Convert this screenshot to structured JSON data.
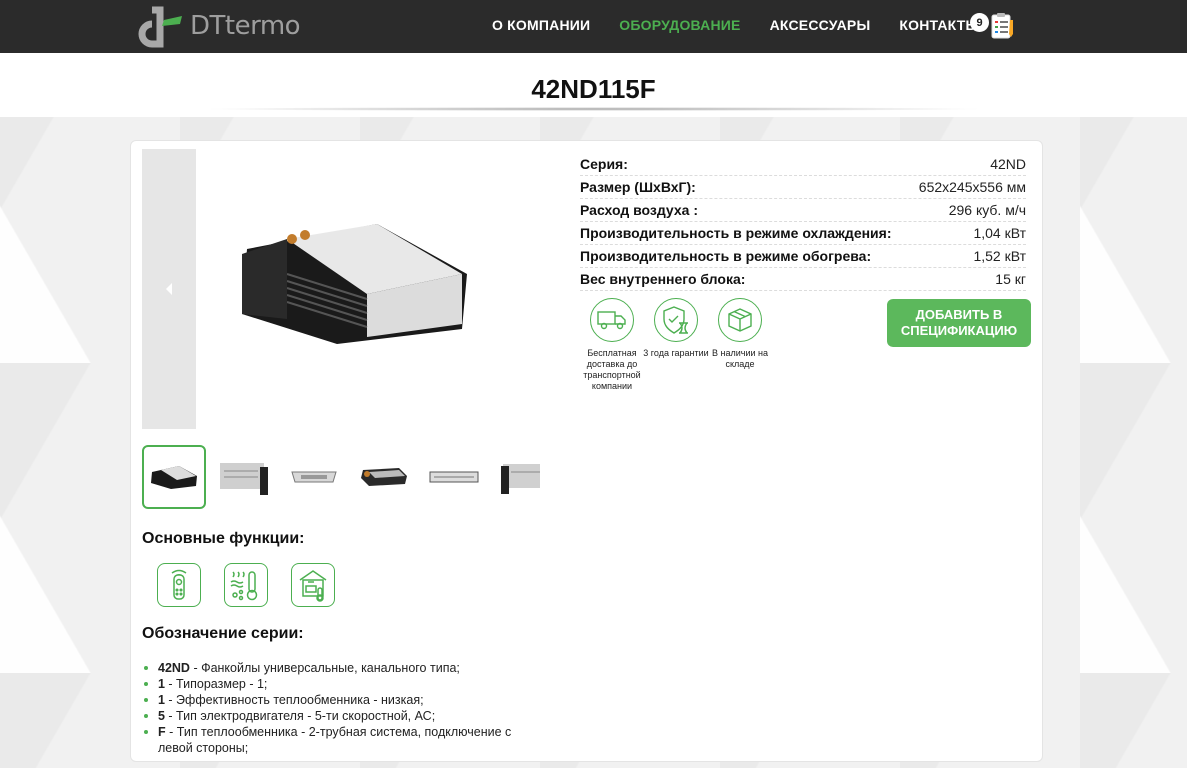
{
  "header": {
    "logo_text": "DTtermo",
    "nav": [
      {
        "label": "О КОМПАНИИ",
        "active": false
      },
      {
        "label": "ОБОРУДОВАНИЕ",
        "active": true
      },
      {
        "label": "АКСЕССУАРЫ",
        "active": false
      },
      {
        "label": "КОНТАКТЫ",
        "active": false
      }
    ],
    "spec_count": "9",
    "spec_icon": "clipboard-list-icon"
  },
  "page_title": "42ND115F",
  "specs": [
    {
      "label": "Серия:",
      "value": "42ND"
    },
    {
      "label": "Размер (ШхВхГ):",
      "value": "652x245x556 мм"
    },
    {
      "label": "Расход воздуха :",
      "value": "296 куб. м/ч"
    },
    {
      "label": "Производительность в режиме охлаждения:",
      "value": "1,04 кВт"
    },
    {
      "label": "Производительность в режиме обогрева:",
      "value": "1,52 кВт"
    },
    {
      "label": "Вес внутреннего блока:",
      "value": "15 кг"
    }
  ],
  "perks": [
    {
      "icon": "truck-icon",
      "text": "Бесплатная доставка до транспортной компании"
    },
    {
      "icon": "shield-hourglass-icon",
      "text": "3 года гарантии"
    },
    {
      "icon": "box-icon",
      "text": "В наличии на складе"
    }
  ],
  "add_button": "ДОБАВИТЬ В СПЕЦИФИКАЦИЮ",
  "functions_title": "Основные функции:",
  "functions": [
    "remote-control-icon",
    "heating-cooling-icon",
    "smart-home-icon"
  ],
  "series_title": "Обозначение серии:",
  "series": [
    {
      "code": "42ND",
      "text": " - Фанкойлы универсальные, канального типа;"
    },
    {
      "code": "1",
      "text": " - Типоразмер - 1;"
    },
    {
      "code": "1",
      "text": " - Эффективность теплообменника - низкая;"
    },
    {
      "code": "5",
      "text": " - Тип электродвигателя - 5-ти скоростной, АС;"
    },
    {
      "code": "F",
      "text": " - Тип теплообменника - 2-трубная система, подключение с левой стороны;"
    }
  ],
  "colors": {
    "accent": "#4caf50",
    "header_bg": "#2b2b2b",
    "button": "#5cb85c"
  }
}
